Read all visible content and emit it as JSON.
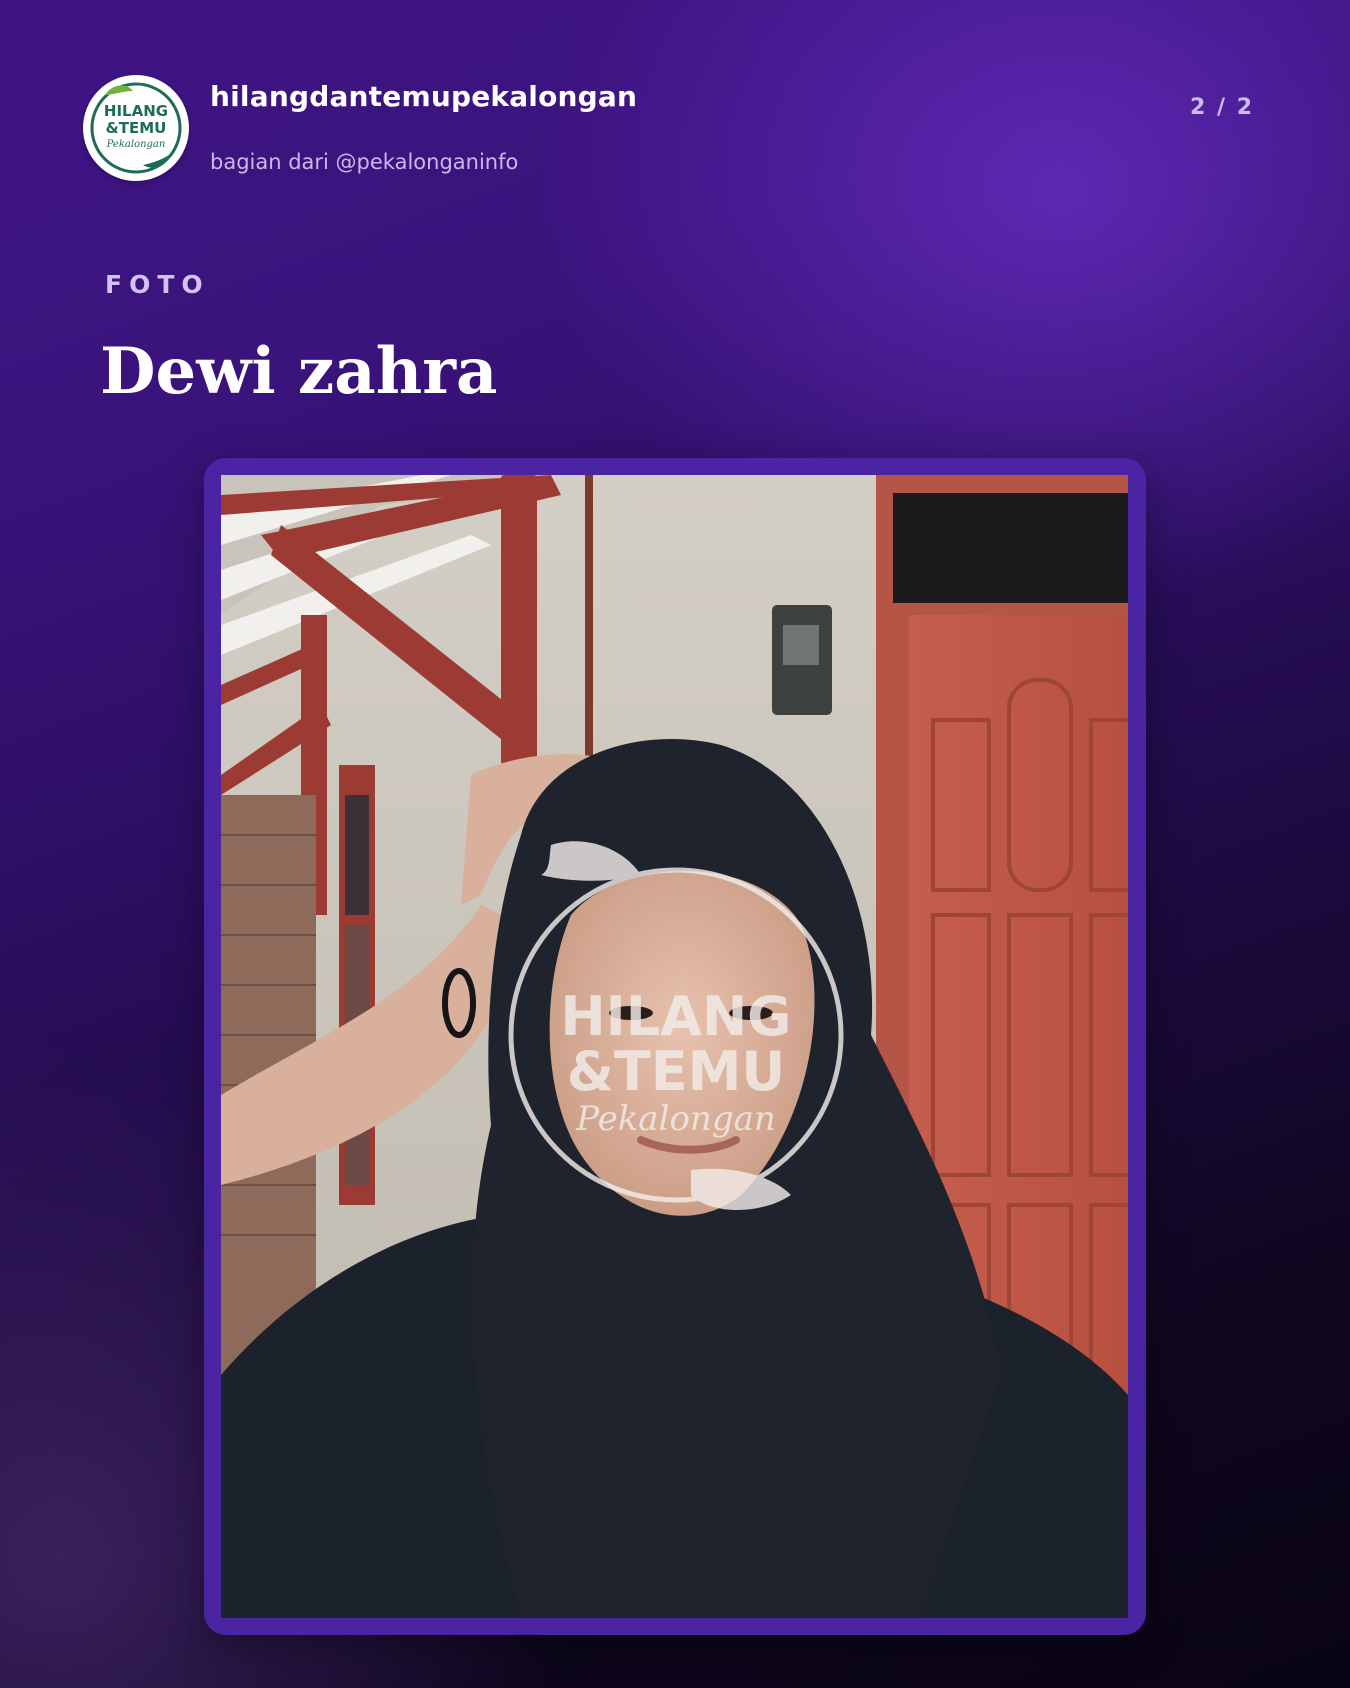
{
  "header": {
    "account_name": "hilangdantemupekalongan",
    "account_sub": "bagian dari @pekalonganinfo",
    "page_counter": "2 / 2",
    "logo": {
      "icon": "hilang-temu-logo-icon",
      "line1": "HILANG",
      "line2": "&TEMU",
      "line3": "Pekalongan"
    }
  },
  "section": {
    "label": "FOTO",
    "person_name": "Dewi zahra"
  },
  "photo": {
    "description_icon": "portrait-photo",
    "watermark": {
      "line1": "HILANG",
      "line2": "&TEMU",
      "line3": "Pekalongan"
    }
  },
  "colors": {
    "brand_green": "#1f6b5a",
    "leaf_green": "#6fb23e",
    "frame_purple": "#4b24a4",
    "label_lavender": "#d2c3f5"
  }
}
